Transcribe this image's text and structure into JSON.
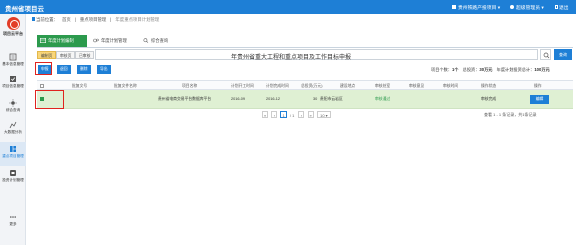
{
  "header": {
    "app_title": "贵州省项目云",
    "company": "贵州铁路产投项目",
    "user": "超级管理员",
    "logout": "退出"
  },
  "sidebar": {
    "items": [
      {
        "label": "项目云平台",
        "icon": "logo-icon"
      },
      {
        "label": "基本信息管理",
        "icon": "list-icon"
      },
      {
        "label": "项目信息管理",
        "icon": "check-icon"
      },
      {
        "label": "综合查询",
        "icon": "sun-icon"
      },
      {
        "label": "大数据分析",
        "icon": "chart-icon"
      },
      {
        "label": "重点项目管理",
        "icon": "grid-icon"
      },
      {
        "label": "投资计划管理",
        "icon": "doc-icon"
      },
      {
        "label": "更多",
        "icon": "dots-icon"
      }
    ]
  },
  "breadcrumb": [
    "当前位置：",
    "首页",
    "重点项目管理",
    "年度重点项目计划管理"
  ],
  "tabs": [
    {
      "label": "年度计划编制",
      "active": true
    },
    {
      "label": "年度计划管理",
      "active": false
    },
    {
      "label": "综合查询",
      "active": false
    }
  ],
  "subtabs": [
    {
      "label": "编制页",
      "active": true
    },
    {
      "label": "审核页",
      "active": false
    },
    {
      "label": "已审核",
      "active": false
    }
  ],
  "search": {
    "value": "年贵州省重大工程和重点项目及工作目标申报",
    "query_label": "查询"
  },
  "actions": [
    "申报",
    "退回",
    "删除",
    "导出"
  ],
  "stats": {
    "count_label": "项目个数：",
    "count_value": "1个",
    "total_label": "总投资：",
    "total_value": "30万元",
    "year_label": "年度计划投资总计：",
    "year_value": "100万元"
  },
  "table": {
    "headers": [
      "",
      "批复文号",
      "批复文件名称",
      "项目名称",
      "计划开工时间",
      "计划完成时间",
      "总投资(万元)",
      "建设地点",
      "审核处室",
      "审核意见",
      "审核时间",
      "操作状态",
      "操作"
    ],
    "rows": [
      {
        "doc_no": "",
        "doc_name": "",
        "name": "贵州省电商交易平台数据库平台",
        "start": "2016-09",
        "end": "2016-12",
        "total_invest": "30",
        "location": "贵阳市云岩区",
        "dept": "审核通过",
        "opinion": "",
        "time": "",
        "status": "审核完成",
        "op_label": "编辑"
      }
    ]
  },
  "pager": {
    "page_value": "1",
    "page_of": "/ 1",
    "page_size": "10",
    "info": "查看 1 - 1 条记录，共1条记录"
  },
  "colors": {
    "primary": "#1e7fd6",
    "green": "#2c9a4d",
    "row_highlight": "#dff0d3",
    "annotation_red": "#e0241f"
  }
}
